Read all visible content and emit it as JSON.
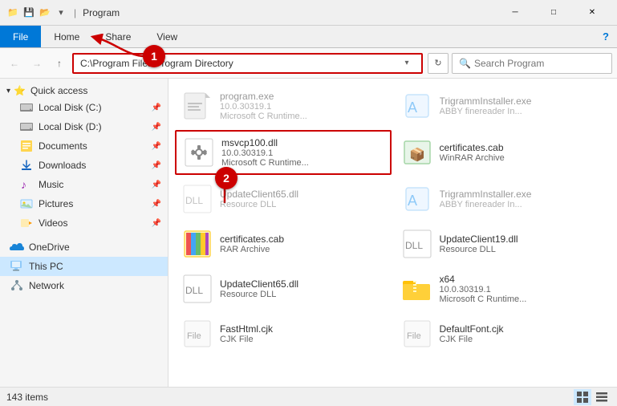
{
  "titleBar": {
    "icons": [
      "📁",
      "💾",
      "📂"
    ],
    "title": "Program",
    "controls": [
      "─",
      "□",
      "✕"
    ]
  },
  "ribbon": {
    "tabs": [
      "File",
      "Home",
      "Share",
      "View"
    ],
    "activeTab": "File",
    "helpIcon": "?"
  },
  "addressBar": {
    "backBtn": "←",
    "forwardBtn": "→",
    "upBtn": "↑",
    "path": "C:\\Program Files\\Program Directory",
    "dropdownIcon": "▾",
    "refreshIcon": "↻",
    "searchPlaceholder": "Search Program",
    "searchIcon": "🔍"
  },
  "sidebar": {
    "quickAccess": {
      "label": "Quick access",
      "icon": "⭐",
      "chevron": "▾"
    },
    "items": [
      {
        "id": "local-disk-c",
        "label": "Local Disk (C:)",
        "icon": "💾",
        "pinned": true,
        "indented": true
      },
      {
        "id": "local-disk-d",
        "label": "Local Disk (D:)",
        "icon": "💾",
        "pinned": true,
        "indented": true
      },
      {
        "id": "documents",
        "label": "Documents",
        "icon": "📄",
        "pinned": true,
        "indented": true
      },
      {
        "id": "downloads",
        "label": "Downloads",
        "icon": "⬇",
        "pinned": true,
        "indented": true
      },
      {
        "id": "music",
        "label": "Music",
        "icon": "♪",
        "pinned": true,
        "indented": true
      },
      {
        "id": "pictures",
        "label": "Pictures",
        "icon": "🖼",
        "pinned": true,
        "indented": true
      },
      {
        "id": "videos",
        "label": "Videos",
        "icon": "🎬",
        "pinned": true,
        "indented": true
      }
    ],
    "oneDrive": {
      "label": "OneDrive",
      "icon": "☁"
    },
    "thisPC": {
      "label": "This PC",
      "icon": "💻",
      "selected": true
    },
    "network": {
      "label": "Network",
      "icon": "🌐"
    }
  },
  "files": [
    {
      "id": "f1",
      "name": "program.exe",
      "detail1": "10.0.30319.1",
      "detail2": "Microsoft C Runtime...",
      "iconType": "exe",
      "highlighted": false,
      "ghost": true
    },
    {
      "id": "f2",
      "name": "TrigrammInstaller.exe",
      "detail1": "ABBY finereader In...",
      "detail2": "",
      "iconType": "installer",
      "highlighted": false,
      "ghost": true
    },
    {
      "id": "f3",
      "name": "msvcp100.dll",
      "detail1": "10.0.30319.1",
      "detail2": "Microsoft C Runtime...",
      "iconType": "dll",
      "highlighted": true,
      "ghost": false
    },
    {
      "id": "f4",
      "name": "certificates.cab",
      "detail1": "WinRAR Archive",
      "detail2": "",
      "iconType": "cab",
      "highlighted": false,
      "ghost": false
    },
    {
      "id": "f5",
      "name": "UpdateClient65.dll",
      "detail1": "Resource DLL",
      "detail2": "",
      "iconType": "dll2",
      "highlighted": false,
      "ghost": true
    },
    {
      "id": "f6",
      "name": "TrigrammInstaller.exe",
      "detail1": "ABBY finereader In...",
      "detail2": "",
      "iconType": "installer2",
      "highlighted": false,
      "ghost": true
    },
    {
      "id": "f7",
      "name": "certificates.cab",
      "detail1": "RAR Archive",
      "detail2": "",
      "iconType": "cab2",
      "highlighted": false,
      "ghost": false
    },
    {
      "id": "f8",
      "name": "UpdateClient19.dll",
      "detail1": "Resource DLL",
      "detail2": "",
      "iconType": "dll3",
      "highlighted": false,
      "ghost": false
    },
    {
      "id": "f9",
      "name": "UpdateClient65.dll",
      "detail1": "Resource DLL",
      "detail2": "",
      "iconType": "dll4",
      "highlighted": false,
      "ghost": false
    },
    {
      "id": "f10",
      "name": "x64",
      "detail1": "10.0.30319.1",
      "detail2": "Microsoft C Runtime...",
      "iconType": "folder",
      "highlighted": false,
      "ghost": false
    },
    {
      "id": "f11",
      "name": "FastHtml.cjk",
      "detail1": "CJK File",
      "detail2": "",
      "iconType": "cjk",
      "highlighted": false,
      "ghost": false
    },
    {
      "id": "f12",
      "name": "DefaultFont.cjk",
      "detail1": "CJK File",
      "detail2": "",
      "iconType": "cjk2",
      "highlighted": false,
      "ghost": false
    }
  ],
  "statusBar": {
    "itemCount": "143 items",
    "viewGrid": "▦",
    "viewList": "▤"
  },
  "annotations": [
    {
      "number": "1",
      "desc": "address-bar-annotation"
    },
    {
      "number": "2",
      "desc": "file-annotation"
    }
  ]
}
